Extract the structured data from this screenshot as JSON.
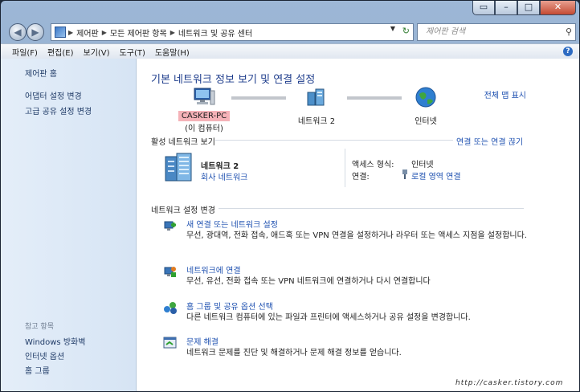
{
  "window": {
    "controls": {
      "minimize": "–",
      "maximize": "□",
      "close": "✕",
      "extra": "▭"
    }
  },
  "nav": {
    "back": "◀",
    "forward": "▶",
    "breadcrumb": [
      "제어판",
      "모든 제어판 항목",
      "네트워크 및 공유 센터"
    ],
    "search_placeholder": "제어판 검색"
  },
  "menu": [
    "파일(F)",
    "편집(E)",
    "보기(V)",
    "도구(T)",
    "도움말(H)"
  ],
  "sidebar": {
    "top_links": [
      "제어판 홈",
      "어댑터 설정 변경",
      "고급 공유 설정 변경"
    ],
    "see_also_heading": "참고 항목",
    "see_also_links": [
      "Windows 방화벽",
      "인터넷 옵션",
      "홈 그룹"
    ]
  },
  "main": {
    "title": "기본 네트워크 정보 보기 및 연결 설정",
    "full_map_link": "전체 맵 표시",
    "map": {
      "computer_name": "CASKER-PC",
      "computer_sub": "(이 컴퓨터)",
      "network_name": "네트워크 2",
      "internet_name": "인터넷"
    },
    "active_section": {
      "label": "활성 네트워크 보기",
      "connect_link": "연결 또는 연결 끊기",
      "network_name": "네트워크 2",
      "network_type": "회사 네트워크",
      "access_label": "액세스 형식:",
      "access_value": "인터넷",
      "connection_label": "연결:",
      "connection_value": "로컬 영역 연결"
    },
    "settings_section": {
      "label": "네트워크 설정 변경",
      "tasks": [
        {
          "title": "새 연결 또는 네트워크 설정",
          "desc": "무선, 광대역, 전화 접속, 애드혹 또는 VPN 연결을 설정하거나 라우터 또는 액세스 지점을 설정합니다."
        },
        {
          "title": "네트워크에 연결",
          "desc": "무선, 유선, 전화 접속 또는 VPN 네트워크에 연결하거나 다시 연결합니다"
        },
        {
          "title": "홈 그룹 및 공유 옵션 선택",
          "desc": "다른 네트워크 컴퓨터에 있는 파일과 프린터에 액세스하거나 공유 설정을 변경합니다."
        },
        {
          "title": "문제 해결",
          "desc": "네트워크 문제를 진단 및 해결하거나 문제 해결 정보를 얻습니다."
        }
      ]
    }
  },
  "watermark": "http://casker.tistory.com"
}
